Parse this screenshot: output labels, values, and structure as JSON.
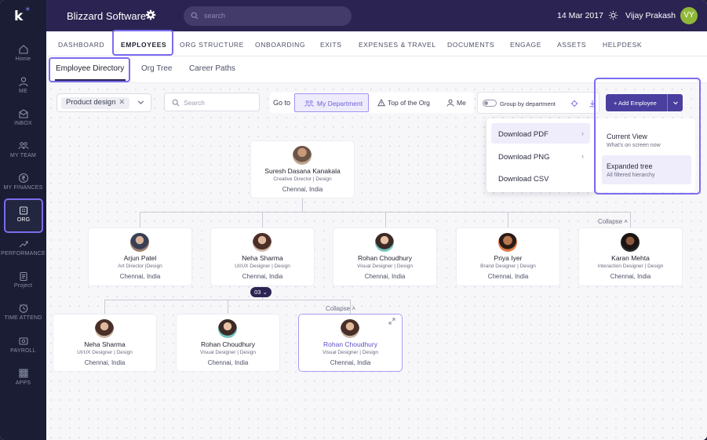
{
  "app": {
    "company": "Blizzard Software",
    "search_placeholder": "search",
    "date": "14 Mar 2017",
    "user_name": "Vijay Prakash",
    "user_initials": "VY"
  },
  "sidebar": {
    "items": [
      {
        "label": "Home",
        "icon": "home-icon"
      },
      {
        "label": "ME",
        "icon": "user-icon"
      },
      {
        "label": "INBOX",
        "icon": "inbox-icon"
      },
      {
        "label": "MY TEAM",
        "icon": "team-icon"
      },
      {
        "label": "MY FINANCES",
        "icon": "rupee-icon"
      },
      {
        "label": "ORG",
        "icon": "building-icon",
        "active": true
      },
      {
        "label": "PERFORMANCE",
        "icon": "trend-icon"
      },
      {
        "label": "Project",
        "icon": "clipboard-icon"
      },
      {
        "label": "TIME ATTEND",
        "icon": "clock-icon"
      },
      {
        "label": "PAYROLL",
        "icon": "payroll-icon"
      },
      {
        "label": "APPS",
        "icon": "grid-icon"
      }
    ]
  },
  "main_tabs": [
    "DASHBOARD",
    "EMPLOYEES",
    "ORG STRUCTURE",
    "ONBOARDING",
    "EXITS",
    "EXPENSES & TRAVEL",
    "DOCUMENTS",
    "ENGAGE",
    "ASSETS",
    "HELPDESK"
  ],
  "active_main_tab": "EMPLOYEES",
  "sub_tabs": [
    "Employee Directory",
    "Org Tree",
    "Career Paths"
  ],
  "active_sub_tab": "Employee Directory",
  "toolbar": {
    "filter_chip": "Product design",
    "search_placeholder": "Search",
    "goto_label": "Go to",
    "goto_options": [
      "My Department",
      "Top of the Org",
      "Me"
    ],
    "goto_selected": "My Department",
    "group_label": "Group by department",
    "add_button": "+ Add Employee"
  },
  "download_menu": {
    "items": [
      "Download PDF",
      "Download PNG",
      "Download CSV"
    ],
    "selected": "Download PDF"
  },
  "pdf_submenu": {
    "items": [
      {
        "title": "Current View",
        "subtitle": "What's on screen now"
      },
      {
        "title": "Expanded tree",
        "subtitle": "All filtered hierarchy"
      }
    ],
    "selected": "Expanded tree"
  },
  "org": {
    "root": {
      "name": "Suresh Dasana Kanakala",
      "role": "Creative Director | Design",
      "location": "Chennai, India"
    },
    "level1": [
      {
        "name": "Arjun Patel",
        "role": "Art Director |Design",
        "location": "Chennai, India"
      },
      {
        "name": "Neha Sharma",
        "role": "UI/UX Designer | Design",
        "location": "Chennai, India"
      },
      {
        "name": "Rohan Choudhury",
        "role": "Visual Designer | Design",
        "location": "Chennai, India"
      },
      {
        "name": "Priya Iyer",
        "role": "Brand Designer | Design",
        "location": "Chennai, India"
      },
      {
        "name": "Karan Mehta",
        "role": "Interaction Designer | Design",
        "location": "Chennai, India"
      }
    ],
    "level2": [
      {
        "name": "Neha Sharma",
        "role": "UI/UX Designer | Design",
        "location": "Chennai, India"
      },
      {
        "name": "Rohan Choudhury",
        "role": "Visual Designer | Design",
        "location": "Chennai, India"
      },
      {
        "name": "Rohan Choudhury",
        "role": "Visual Designer | Design",
        "location": "Chennai, India",
        "highlighted": true
      }
    ],
    "report_count": "03",
    "collapse_label": "Collapse",
    "collapse_label_2": "Collapse"
  },
  "colors": {
    "topbar": "#2b2452",
    "sidebar": "#1a1d33",
    "accent": "#7c6cf0",
    "primary_button": "#4a3f9e"
  }
}
